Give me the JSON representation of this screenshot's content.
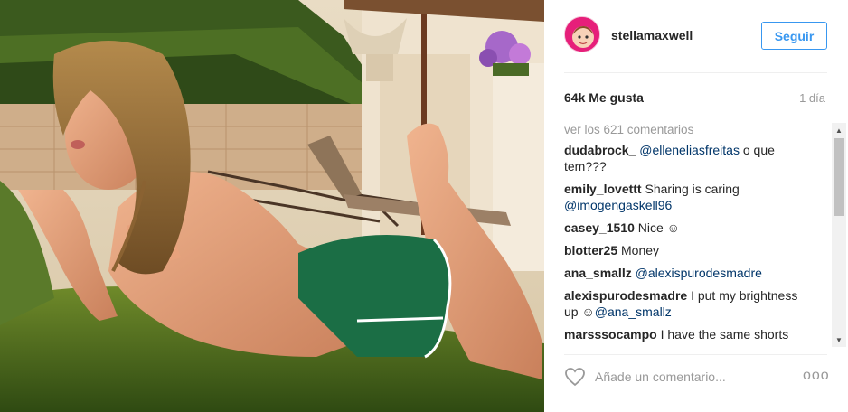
{
  "post": {
    "username": "stellamaxwell",
    "follow_label": "Seguir",
    "likes": "64k Me gusta",
    "date": "1 día",
    "view_all_comments": "ver los 621 comentarios",
    "comments": [
      {
        "user": "dudabrock_",
        "mention": "@elleneliasfreitas",
        "text": " o que tem???"
      },
      {
        "user": "emily_lovettt",
        "mention": "",
        "text": "Sharing is caring",
        "mention_after": "@imogengaskell96"
      },
      {
        "user": "casey_1510",
        "mention": "",
        "text": "Nice ☺"
      },
      {
        "user": "blotter25",
        "mention": "",
        "text": "Money"
      },
      {
        "user": "ana_smallz",
        "mention": "@alexispurodesmadre",
        "text": ""
      },
      {
        "user": "alexispurodesmadre",
        "mention": "",
        "text": "I put my brightness up ☺",
        "mention_after": "@ana_smallz"
      },
      {
        "user": "marsssocampo",
        "mention": "",
        "text": "I have the same shorts"
      }
    ],
    "comment_placeholder": "Añade un comentario...",
    "more_label": "ooo",
    "icons": {
      "heart": "heart-icon",
      "more": "more-options-icon",
      "scroll_up": "scroll-up-icon",
      "scroll_down": "scroll-down-icon"
    },
    "colors": {
      "accent": "#3897f0",
      "mention": "#003569",
      "muted": "#999999",
      "text": "#262626"
    }
  }
}
